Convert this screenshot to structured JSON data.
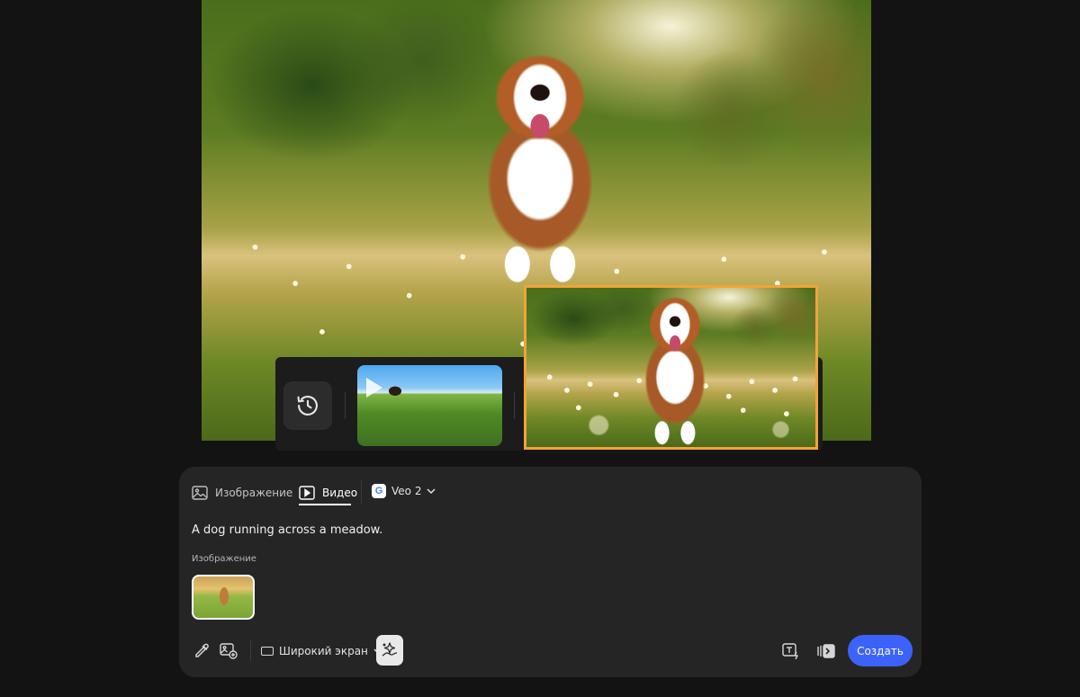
{
  "history": {
    "icon": "history-icon"
  },
  "tabs": {
    "image_label": "Изображение",
    "video_label": "Видео",
    "active": "video"
  },
  "model": {
    "label": "Veo 2",
    "icon": "google-icon",
    "icon_glyph": "G"
  },
  "prompt": {
    "text": "A dog running across a meadow."
  },
  "reference": {
    "section_label": "Изображение"
  },
  "toolbar": {
    "aspect_label": "Широкий экран",
    "create_label": "Создать"
  },
  "colors": {
    "selected_thumb_border": "#f2a33a",
    "create_button": "#3b63fb",
    "panel_background": "#252525",
    "page_background": "#131313"
  }
}
